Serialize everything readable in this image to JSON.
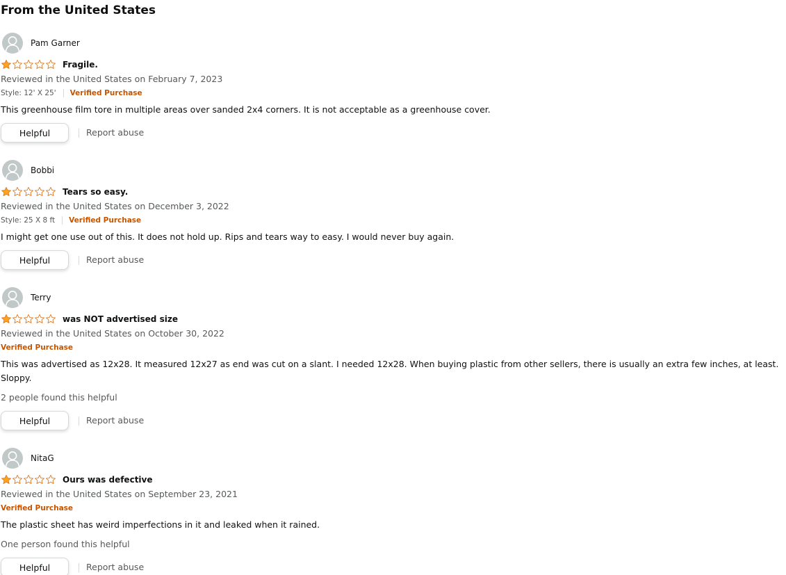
{
  "section_title": "From the United States",
  "helpful_button_label": "Helpful",
  "report_abuse_label": "Report abuse",
  "colors": {
    "star_fill": "#ffa41c",
    "star_outline": "#de7921",
    "verified": "#c45500",
    "muted_text": "#565959"
  },
  "reviews": [
    {
      "profile_name": "Pam Garner",
      "rating": 1,
      "max_rating": 5,
      "title": "Fragile.",
      "date_line": "Reviewed in the United States on February 7, 2023",
      "style": "Style: 12' X 25'",
      "verified_label": "Verified Purchase",
      "body": "This greenhouse film tore in multiple areas over sanded 2x4 corners. It is not acceptable as a greenhouse cover.",
      "helpful_count": ""
    },
    {
      "profile_name": "Bobbi",
      "rating": 1,
      "max_rating": 5,
      "title": "Tears so easy.",
      "date_line": "Reviewed in the United States on December 3, 2022",
      "style": "Style: 25 X 8 ft",
      "verified_label": "Verified Purchase",
      "body": "I might get one use out of this. It does not hold up. Rips and tears way to easy. I would never buy again.",
      "helpful_count": ""
    },
    {
      "profile_name": "Terry",
      "rating": 1,
      "max_rating": 5,
      "title": "was NOT advertised size",
      "date_line": "Reviewed in the United States on October 30, 2022",
      "style": "",
      "verified_label": "Verified Purchase",
      "body": "This was advertised as 12x28. It measured 12x27 as end was cut on a slant. I needed 12x28. When buying plastic from other sellers, there is usually an extra few inches, at least. Sloppy.",
      "helpful_count": "2 people found this helpful"
    },
    {
      "profile_name": "NitaG",
      "rating": 1,
      "max_rating": 5,
      "title": "Ours was defective",
      "date_line": "Reviewed in the United States on September 23, 2021",
      "style": "",
      "verified_label": "Verified Purchase",
      "body": "The plastic sheet has weird imperfections in it and leaked when it rained.",
      "helpful_count": "One person found this helpful"
    }
  ]
}
